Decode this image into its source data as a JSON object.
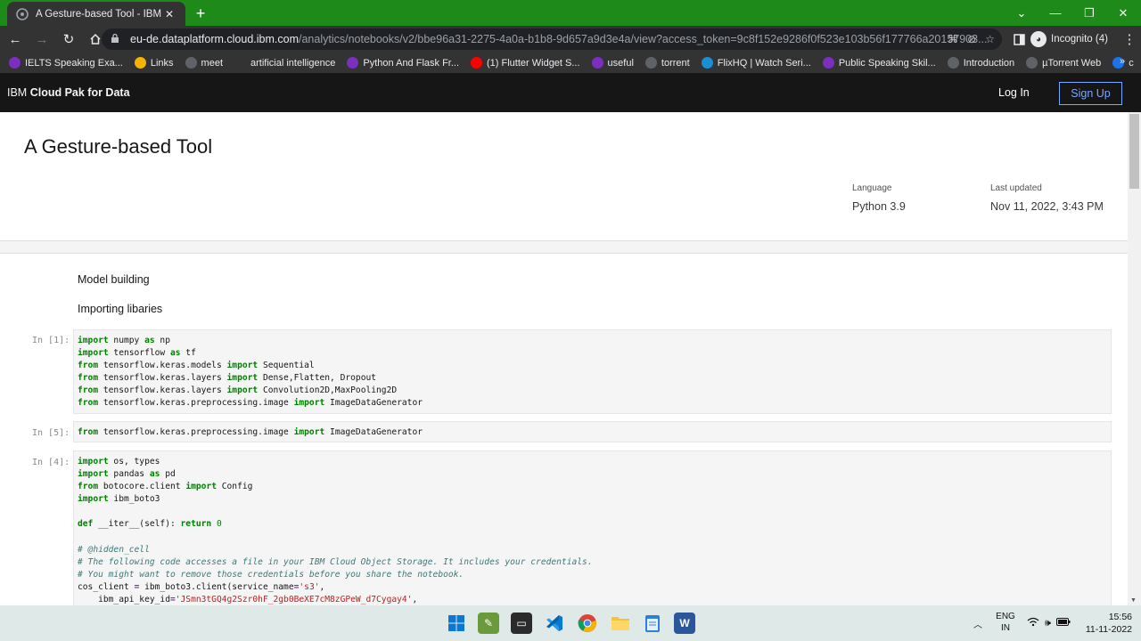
{
  "browser": {
    "tab_title": "A Gesture-based Tool - IBM Clou",
    "tab_close": "✕",
    "new_tab": "+",
    "url_host": "eu-de.dataplatform.cloud.ibm.com",
    "url_path": "/analytics/notebooks/v2/bbe96a31-2275-4a0a-b1b8-9d657a9d3e4a/view?access_token=9c8f152e9286f0f523e103b56f177766a20157903...",
    "profile_label": "Incognito (4)",
    "bookmarks": [
      {
        "label": "IELTS Speaking Exa...",
        "color": "#7b2fbf"
      },
      {
        "label": "Links",
        "color": "#f4b400"
      },
      {
        "label": "meet",
        "color": "#5f6368"
      },
      {
        "label": "artificial intelligence",
        "color": "#333333"
      },
      {
        "label": "Python And Flask Fr...",
        "color": "#7b2fbf"
      },
      {
        "label": "(1) Flutter Widget S...",
        "color": "#ff0000"
      },
      {
        "label": "useful",
        "color": "#7b2fbf"
      },
      {
        "label": "torrent",
        "color": "#5f6368"
      },
      {
        "label": "FlixHQ | Watch Seri...",
        "color": "#1a8fd6"
      },
      {
        "label": "Public Speaking Skil...",
        "color": "#7b2fbf"
      },
      {
        "label": "Introduction",
        "color": "#5f6368"
      },
      {
        "label": "µTorrent Web",
        "color": "#5f6368"
      },
      {
        "label": "c",
        "color": "#1a73e8"
      }
    ],
    "bookmarks_more": "»"
  },
  "ibm_header": {
    "brand_prefix": "IBM ",
    "brand_name": "Cloud Pak for Data",
    "login_label": "Log In",
    "signup_label": "Sign Up"
  },
  "notebook": {
    "title": "A Gesture-based Tool",
    "language_label": "Language",
    "language_value": "Python 3.9",
    "updated_label": "Last updated",
    "updated_value": "Nov 11, 2022, 3:43 PM",
    "md_model_building": "Model building",
    "md_importing": "Importing libaries",
    "cell1_prompt": "In [1]:",
    "cell2_prompt": "In [5]:",
    "cell3_prompt": "In [4]:"
  },
  "taskbar": {
    "lang_top": "ENG",
    "lang_bottom": "IN",
    "time": "15:56",
    "date": "11-11-2022"
  },
  "colors": {
    "tabstrip": "#1e8a1a",
    "ibm_header": "#161616",
    "signup_border": "#78a9ff",
    "code_keyword": "#008000"
  }
}
